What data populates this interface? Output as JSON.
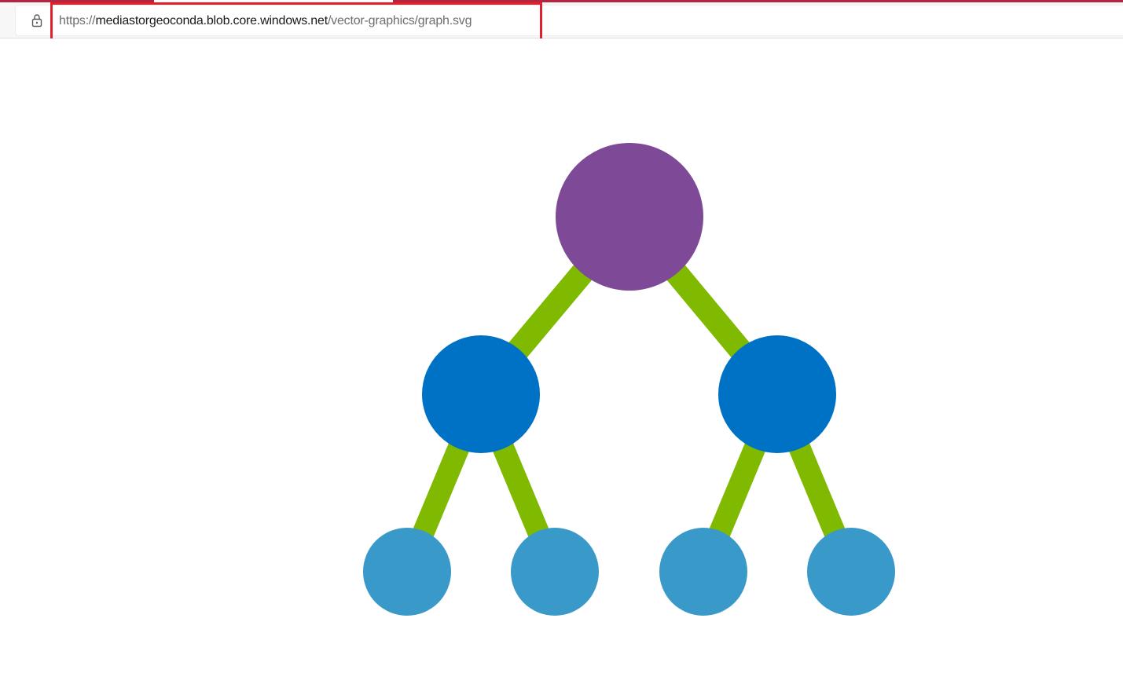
{
  "browser": {
    "url": {
      "scheme": "https://",
      "host": "mediastorgeoconda.blob.core.windows.net",
      "path": "/vector-graphics/graph.svg"
    },
    "icons": {
      "security": "lock-icon"
    },
    "highlight_color": "#e0202a",
    "accent_color": "#b4263f"
  },
  "graph": {
    "colors": {
      "root": "#7e4a98",
      "middle": "#0072c6",
      "leaf": "#3999c8",
      "edge": "#7fba00"
    },
    "nodes": [
      {
        "id": "root",
        "level": "root"
      },
      {
        "id": "middle-left",
        "level": "middle"
      },
      {
        "id": "middle-right",
        "level": "middle"
      },
      {
        "id": "leaf-1",
        "level": "leaf"
      },
      {
        "id": "leaf-2",
        "level": "leaf"
      },
      {
        "id": "leaf-3",
        "level": "leaf"
      },
      {
        "id": "leaf-4",
        "level": "leaf"
      }
    ],
    "edges": [
      [
        "root",
        "middle-left"
      ],
      [
        "root",
        "middle-right"
      ],
      [
        "middle-left",
        "leaf-1"
      ],
      [
        "middle-left",
        "leaf-2"
      ],
      [
        "middle-right",
        "leaf-3"
      ],
      [
        "middle-right",
        "leaf-4"
      ]
    ]
  }
}
